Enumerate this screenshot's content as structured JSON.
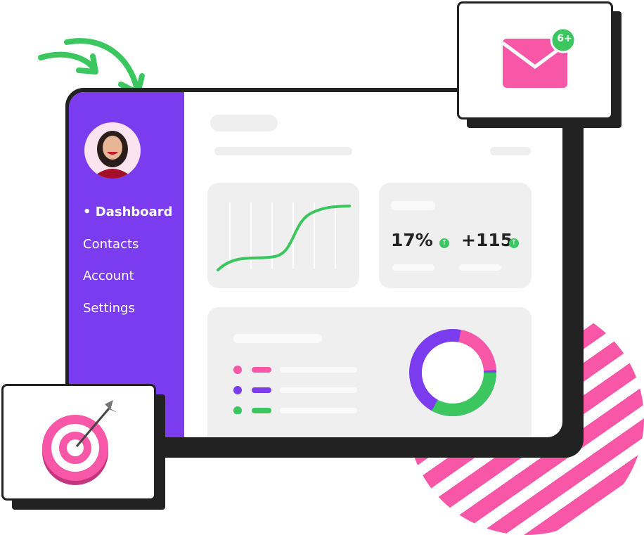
{
  "sidebar": {
    "items": [
      {
        "label": "• Dashboard",
        "active": true
      },
      {
        "label": "Contacts"
      },
      {
        "label": "Account"
      },
      {
        "label": "Settings"
      }
    ]
  },
  "stats": [
    {
      "value": "17%",
      "trend": "up"
    },
    {
      "value": "+115",
      "trend": "up"
    }
  ],
  "notification": {
    "icon": "mail-icon",
    "badge": "6+"
  },
  "target": {
    "icon": "target-dart-icon"
  },
  "colors": {
    "sidebar": "#7a3cee",
    "accent_pink": "#f857a8",
    "accent_green": "#3cc65f",
    "frame": "#222222"
  },
  "legend": [
    {
      "color": "#f857a8"
    },
    {
      "color": "#7a3cee"
    },
    {
      "color": "#3cc65f"
    }
  ]
}
